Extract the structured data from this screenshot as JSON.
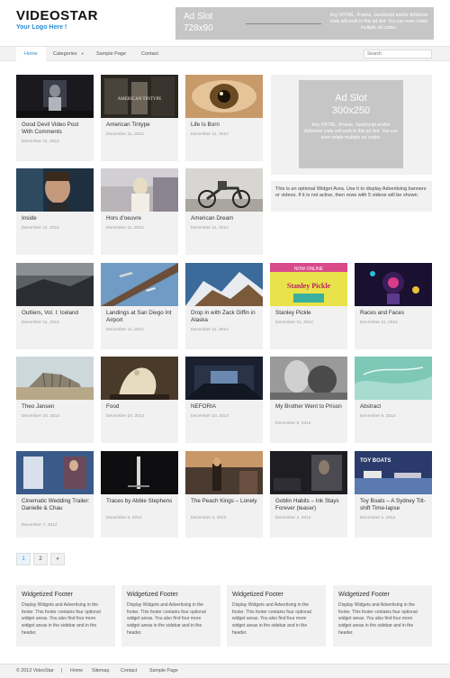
{
  "header": {
    "site_title": "VIDEOSTAR",
    "tagline": "Your Logo Here !",
    "ad_label_line1": "Ad Slot",
    "ad_label_line2": "728x90",
    "ad_text": "Any XHTML, IFrame, JavaScript and/or AdSense code will work in this ad slot. You can even rotate multiple ad codes."
  },
  "nav": {
    "items": [
      {
        "label": "Home"
      },
      {
        "label": "Categories"
      },
      {
        "label": "Sample Page"
      },
      {
        "label": "Contact"
      }
    ],
    "search_placeholder": "Search"
  },
  "posts": [
    {
      "title": "Good Devil Video Post With Comments",
      "date": "December 11, 2012"
    },
    {
      "title": "American Tintype",
      "date": "December 11, 2012"
    },
    {
      "title": "Life Is Born",
      "date": "December 11, 2012"
    },
    {
      "title": "Inside",
      "date": "December 11, 2012"
    },
    {
      "title": "Hors d'oeuvre",
      "date": "December 11, 2012"
    },
    {
      "title": "American Dream",
      "date": "December 11, 2012"
    },
    {
      "title": "Outliers, Vol. I: Iceland",
      "date": "December 11, 2012"
    },
    {
      "title": "Landings at San Diego Int Airport",
      "date": "December 11, 2012"
    },
    {
      "title": "Drop in with Zack Giffin in Alaska",
      "date": "December 11, 2012"
    },
    {
      "title": "Stanley Pickle",
      "date": "December 11, 2012"
    },
    {
      "title": "Races and Faces",
      "date": "December 11, 2012"
    },
    {
      "title": "Theo Jansen",
      "date": "December 10, 2012"
    },
    {
      "title": "Food",
      "date": "December 10, 2012"
    },
    {
      "title": "NEFORIA",
      "date": "December 10, 2012"
    },
    {
      "title": "My Brother Went to Prison",
      "date": "December 9, 2012"
    },
    {
      "title": "Abstract",
      "date": "December 9, 2012"
    },
    {
      "title": "Cinematic Wedding Trailer: Danielle & Chau",
      "date": "December 7, 2012"
    },
    {
      "title": "Traces by Abbie Stephens",
      "date": "December 6, 2012"
    },
    {
      "title": "The Peach Kings – Lonely",
      "date": "December 4, 2012"
    },
    {
      "title": "Goblin Habits – Ink Stays Forever (teaser)",
      "date": "December 2, 2012"
    },
    {
      "title": "Toy Boats – A Sydney Tilt-shift Time-lapse",
      "date": "December 1, 2012"
    }
  ],
  "thumb_overlays": {
    "tintype": "AMERICAN TINTYPE",
    "stanley_top": "NOW ONLINE",
    "stanley_main": "Stanley Pickle",
    "toy": "TOY BOATS"
  },
  "sidebar_ad": {
    "line1": "Ad Slot",
    "line2": "300x250",
    "text": "Any XHTML, IFrame, JavaScript and/or AdSense code will work in this ad slot. You can even rotate multiple ad codes."
  },
  "widget_text": "This is an optional Widget Area. Use it to display Advertising banners or videos. If it is not active, then rows with 5 videos will be shown.",
  "pagination": [
    "1",
    "2",
    "»"
  ],
  "footer_widgets": [
    {
      "title": "Widgetized Footer",
      "text": "Display Widgets and Advertising in the footer. This footer contains four optional widget areas. You also find four more widget areas in the sidebar and in the header."
    },
    {
      "title": "Widgetized Footer",
      "text": "Display Widgets and Advertising in the footer. This footer contains four optional widget areas. You also find four more widget areas in the sidebar and in the header."
    },
    {
      "title": "Widgetized Footer",
      "text": "Display Widgets and Advertising in the footer. This footer contains four optional widget areas. You also find four more widget areas in the sidebar and in the header."
    },
    {
      "title": "Widgetized Footer",
      "text": "Display Widgets and Advertising in the footer. This footer contains four optional widget areas. You also find four more widget areas in the sidebar and in the header."
    }
  ],
  "bottom": {
    "copyright": "© 2013 VideoStar",
    "separator": "|",
    "links": [
      "Home",
      "Sitemap",
      "Contact",
      "Sample Page"
    ]
  },
  "colors": {
    "accent": "#2a8ad2",
    "card_bg": "#f1f1f1",
    "ad_gray": "#c6c6c6"
  }
}
